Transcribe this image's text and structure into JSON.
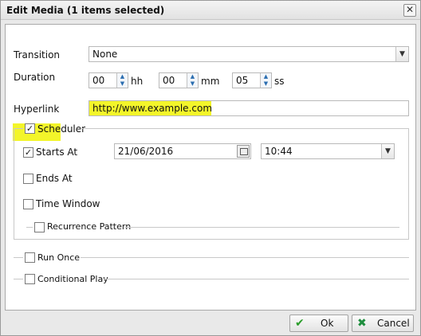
{
  "window": {
    "title": "Edit Media (1 items selected)"
  },
  "icons": {
    "close": "close-icon",
    "check": "check-icon",
    "cancel": "cancel-icon",
    "calendar": "calendar-icon"
  },
  "colors": {
    "highlight": "#f3f52a",
    "ok_icon": "#2a9d2a",
    "cancel_icon": "#1e8e3e"
  },
  "form": {
    "transition": {
      "label": "Transition",
      "value": "None"
    },
    "duration": {
      "label": "Duration",
      "hh": "00",
      "hh_unit": "hh",
      "mm": "00",
      "mm_unit": "mm",
      "ss": "05",
      "ss_unit": "ss"
    },
    "hyperlink": {
      "label": "Hyperlink",
      "value": "http://www.example.com"
    }
  },
  "scheduler": {
    "label": "Scheduler",
    "checked": true,
    "starts_at": {
      "label": "Starts At",
      "checked": true,
      "date": "21/06/2016",
      "time": "10:44"
    },
    "ends_at": {
      "label": "Ends At",
      "checked": false
    },
    "time_window": {
      "label": "Time Window",
      "checked": false
    },
    "recurrence": {
      "label": "Recurrence Pattern",
      "checked": false
    }
  },
  "run_once": {
    "label": "Run Once",
    "checked": false
  },
  "conditional_play": {
    "label": "Conditional Play",
    "checked": false
  },
  "buttons": {
    "ok": "Ok",
    "cancel": "Cancel"
  }
}
